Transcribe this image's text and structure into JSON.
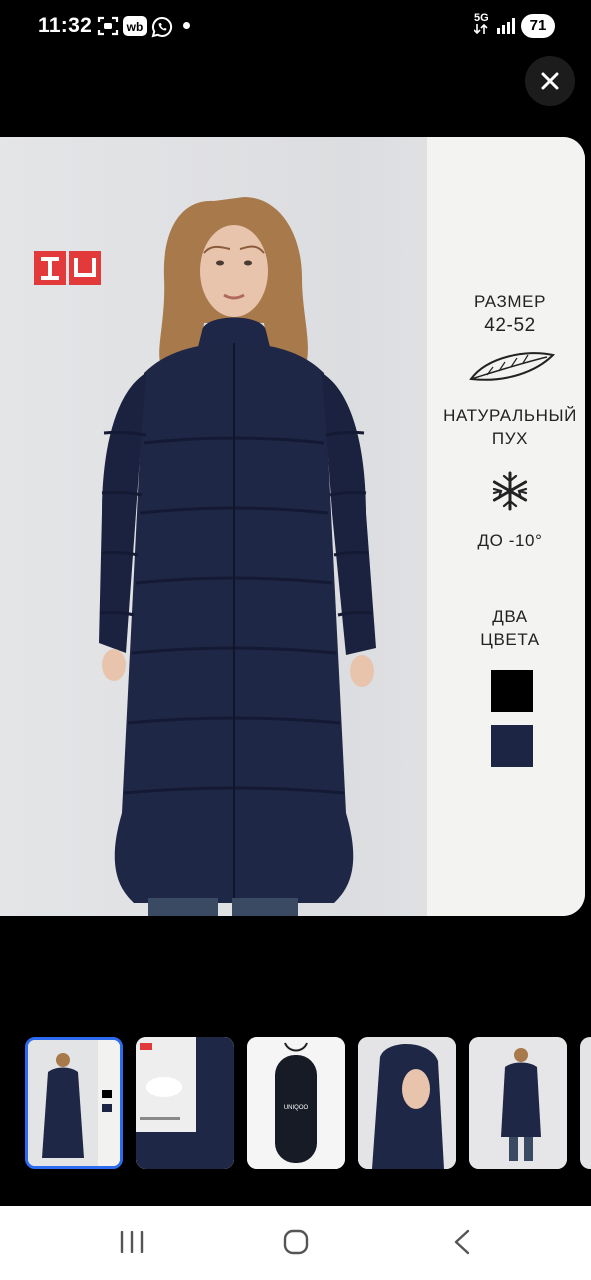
{
  "status_bar": {
    "time": "11:32",
    "icons": [
      "screenshot-icon",
      "wb-app-icon",
      "whatsapp-icon",
      "notification-dot"
    ],
    "wb_label": "wb",
    "network": "5G",
    "battery": "71"
  },
  "viewer": {
    "close_icon": "close-icon"
  },
  "main_image": {
    "brand_logo": "UNIQOO-logo",
    "size_label": "РАЗМЕР",
    "size_range": "42-52",
    "down_line1": "НАТУРАЛЬНЫЙ",
    "down_line2": "ПУХ",
    "temperature": "ДО -10°",
    "colors_line1": "ДВА",
    "colors_line2": "ЦВЕТА",
    "color_swatches": [
      "#000000",
      "#1d2545"
    ]
  },
  "thumbnails": [
    {
      "name": "front-view",
      "selected": true
    },
    {
      "name": "features-view",
      "selected": false
    },
    {
      "name": "bag-view",
      "selected": false
    },
    {
      "name": "hood-view",
      "selected": false
    },
    {
      "name": "full-view",
      "selected": false
    },
    {
      "name": "partial-view",
      "selected": false
    }
  ],
  "bag_text": "UNIQOO",
  "nav_bar": {
    "icons": [
      "recent-apps-icon",
      "home-icon",
      "back-icon"
    ]
  }
}
